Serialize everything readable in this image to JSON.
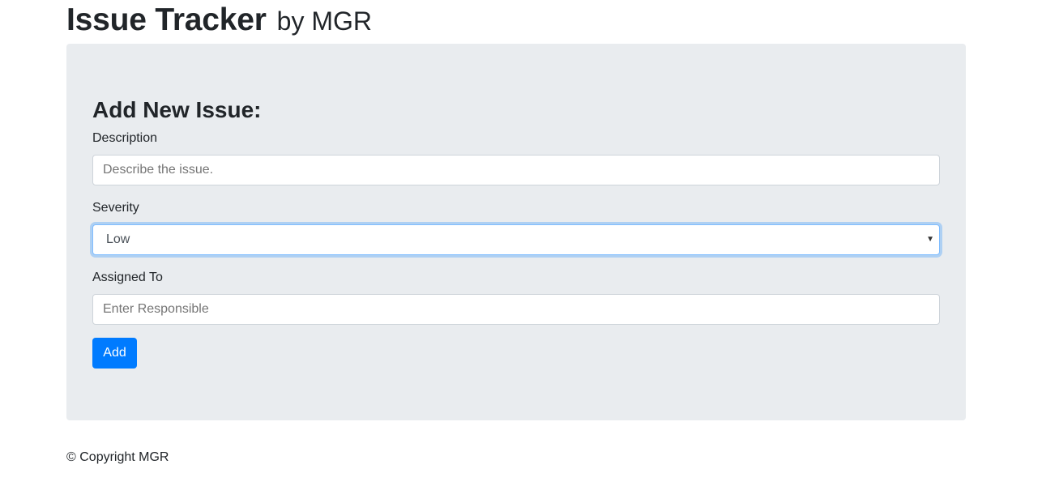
{
  "header": {
    "title": "Issue Tracker",
    "subtitle": "by MGR"
  },
  "form": {
    "heading": "Add New Issue:",
    "description": {
      "label": "Description",
      "placeholder": "Describe the issue.",
      "value": ""
    },
    "severity": {
      "label": "Severity",
      "selected": "Low"
    },
    "assigned_to": {
      "label": "Assigned To",
      "placeholder": "Enter Responsible",
      "value": ""
    },
    "add_label": "Add"
  },
  "footer": {
    "copyright": "© Copyright MGR"
  },
  "colors": {
    "primary": "#007bff",
    "jumbotron_bg": "#e9ecef",
    "focus_border": "#80bdff"
  }
}
